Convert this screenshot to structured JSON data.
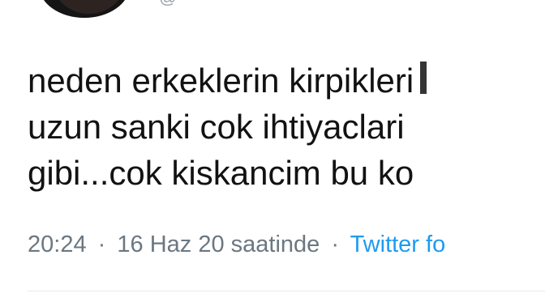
{
  "tweet": {
    "text_lines": [
      "neden erkeklerin kirpikleri",
      "uzun sanki cok ihtiyaclari",
      "gibi...cok kiskancim bu ko"
    ],
    "time": "20:24",
    "date_phrase": "16 Haz 20 saatinde",
    "source": "Twitter fo"
  },
  "colors": {
    "text": "#121212",
    "meta": "#6b7781",
    "link": "#1d9bf0",
    "divider": "#e7ebee"
  }
}
